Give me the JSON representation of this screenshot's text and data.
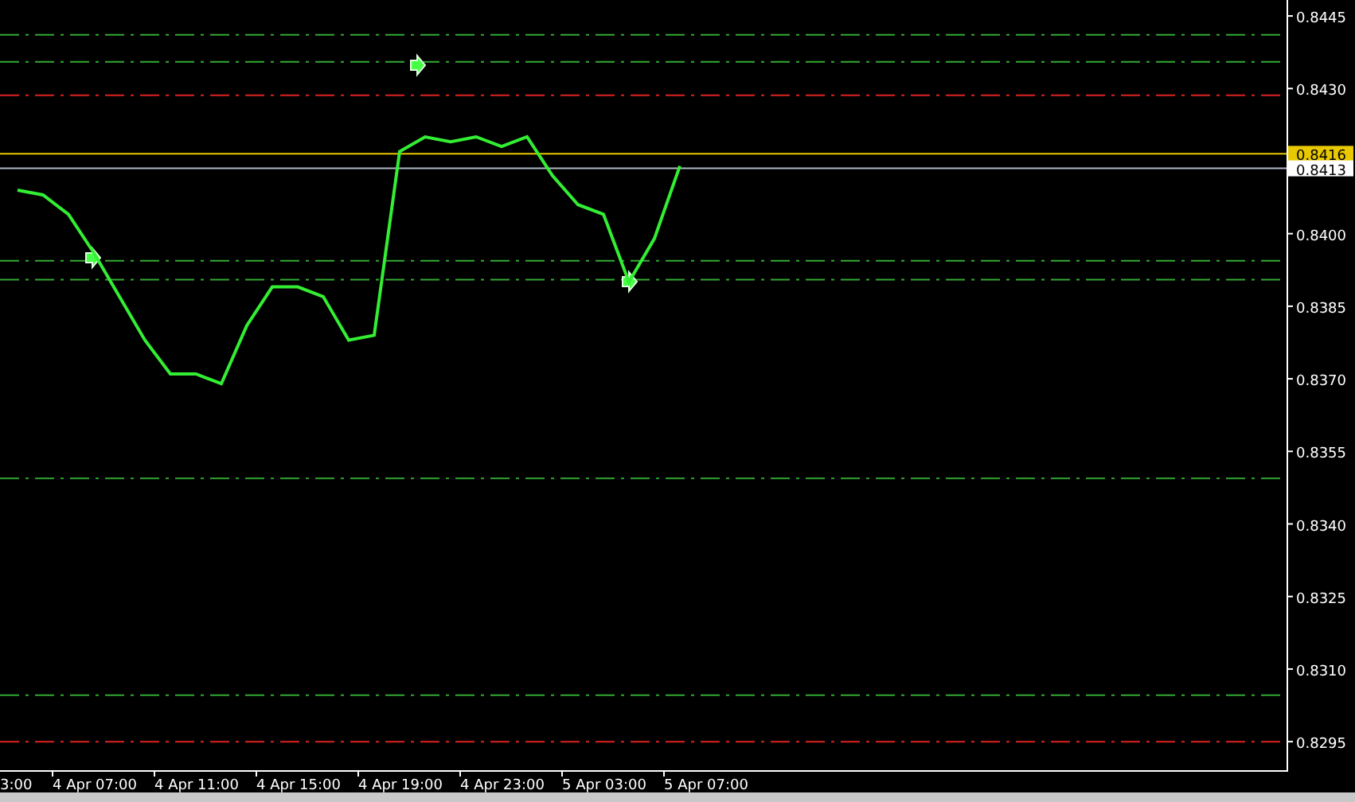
{
  "chart": {
    "chart_data": {
      "type": "line",
      "ylim": [
        0.82891,
        0.84483
      ],
      "categories": [
        null,
        null,
        null,
        "4 Apr 07:00",
        null,
        null,
        null,
        "4 Apr 11:00",
        null,
        null,
        null,
        "4 Apr 15:00",
        null,
        null,
        null,
        "4 Apr 19:00",
        null,
        null,
        null,
        "4 Apr 23:00",
        null,
        null,
        null,
        "5 Apr 03:00",
        null,
        null,
        null,
        "5 Apr 07:00",
        null,
        null,
        null,
        null,
        null,
        null,
        null,
        null,
        null,
        null,
        null,
        null,
        null,
        null,
        null,
        null,
        null,
        null,
        null,
        null,
        null,
        null
      ],
      "series": [
        {
          "color": "#33ee33",
          "values": [
            0.8409,
            0.8408,
            0.8404,
            0.8396,
            0.8387,
            0.8378,
            0.8371,
            0.8371,
            0.8369,
            0.8381,
            0.8389,
            0.8389,
            0.8387,
            0.8378,
            0.8379,
            0.8417,
            0.842,
            0.8419,
            0.842,
            0.8418,
            0.842,
            0.8412,
            0.8406,
            0.8404,
            0.839,
            0.8399,
            0.8414,
            null,
            null,
            null,
            null,
            null,
            null,
            null,
            null,
            null,
            null,
            null,
            null,
            null,
            null,
            null,
            null,
            null,
            null,
            null,
            null,
            null,
            null,
            null
          ]
        }
      ],
      "yticks": [
        {
          "value": 0.8445,
          "label": "0.8445"
        },
        {
          "value": 0.843,
          "label": "0.8430"
        },
        {
          "value": 0.84,
          "label": "0.8400"
        },
        {
          "value": 0.8385,
          "label": "0.8385"
        },
        {
          "value": 0.837,
          "label": "0.8370"
        },
        {
          "value": 0.8355,
          "label": "0.8355"
        },
        {
          "value": 0.834,
          "label": "0.8340"
        },
        {
          "value": 0.8325,
          "label": "0.8325"
        },
        {
          "value": 0.831,
          "label": "0.8310"
        },
        {
          "value": 0.8295,
          "label": "0.8295"
        }
      ],
      "ref_lines": [
        {
          "axis": "y",
          "value": 0.84411,
          "color": "#33aa33"
        },
        {
          "axis": "y",
          "value": 0.84355,
          "color": "#33aa33"
        },
        {
          "axis": "y",
          "value": 0.84286,
          "color": "#dd2222"
        },
        {
          "axis": "y",
          "value": 0.84165,
          "color": "#e8c800",
          "label": "0.8416"
        },
        {
          "axis": "y",
          "value": 0.84135,
          "color": "#b0b8c8",
          "label": "0.8413"
        },
        {
          "axis": "y",
          "value": 0.83944,
          "color": "#33aa33"
        },
        {
          "axis": "y",
          "value": 0.83905,
          "color": "#33aa33"
        },
        {
          "axis": "y",
          "value": 0.83494,
          "color": "#33aa33"
        },
        {
          "axis": "y",
          "value": 0.83046,
          "color": "#33aa33"
        },
        {
          "axis": "y",
          "value": 0.8295,
          "color": "#dd2222"
        }
      ]
    },
    "cut_time_label": "3:00"
  }
}
